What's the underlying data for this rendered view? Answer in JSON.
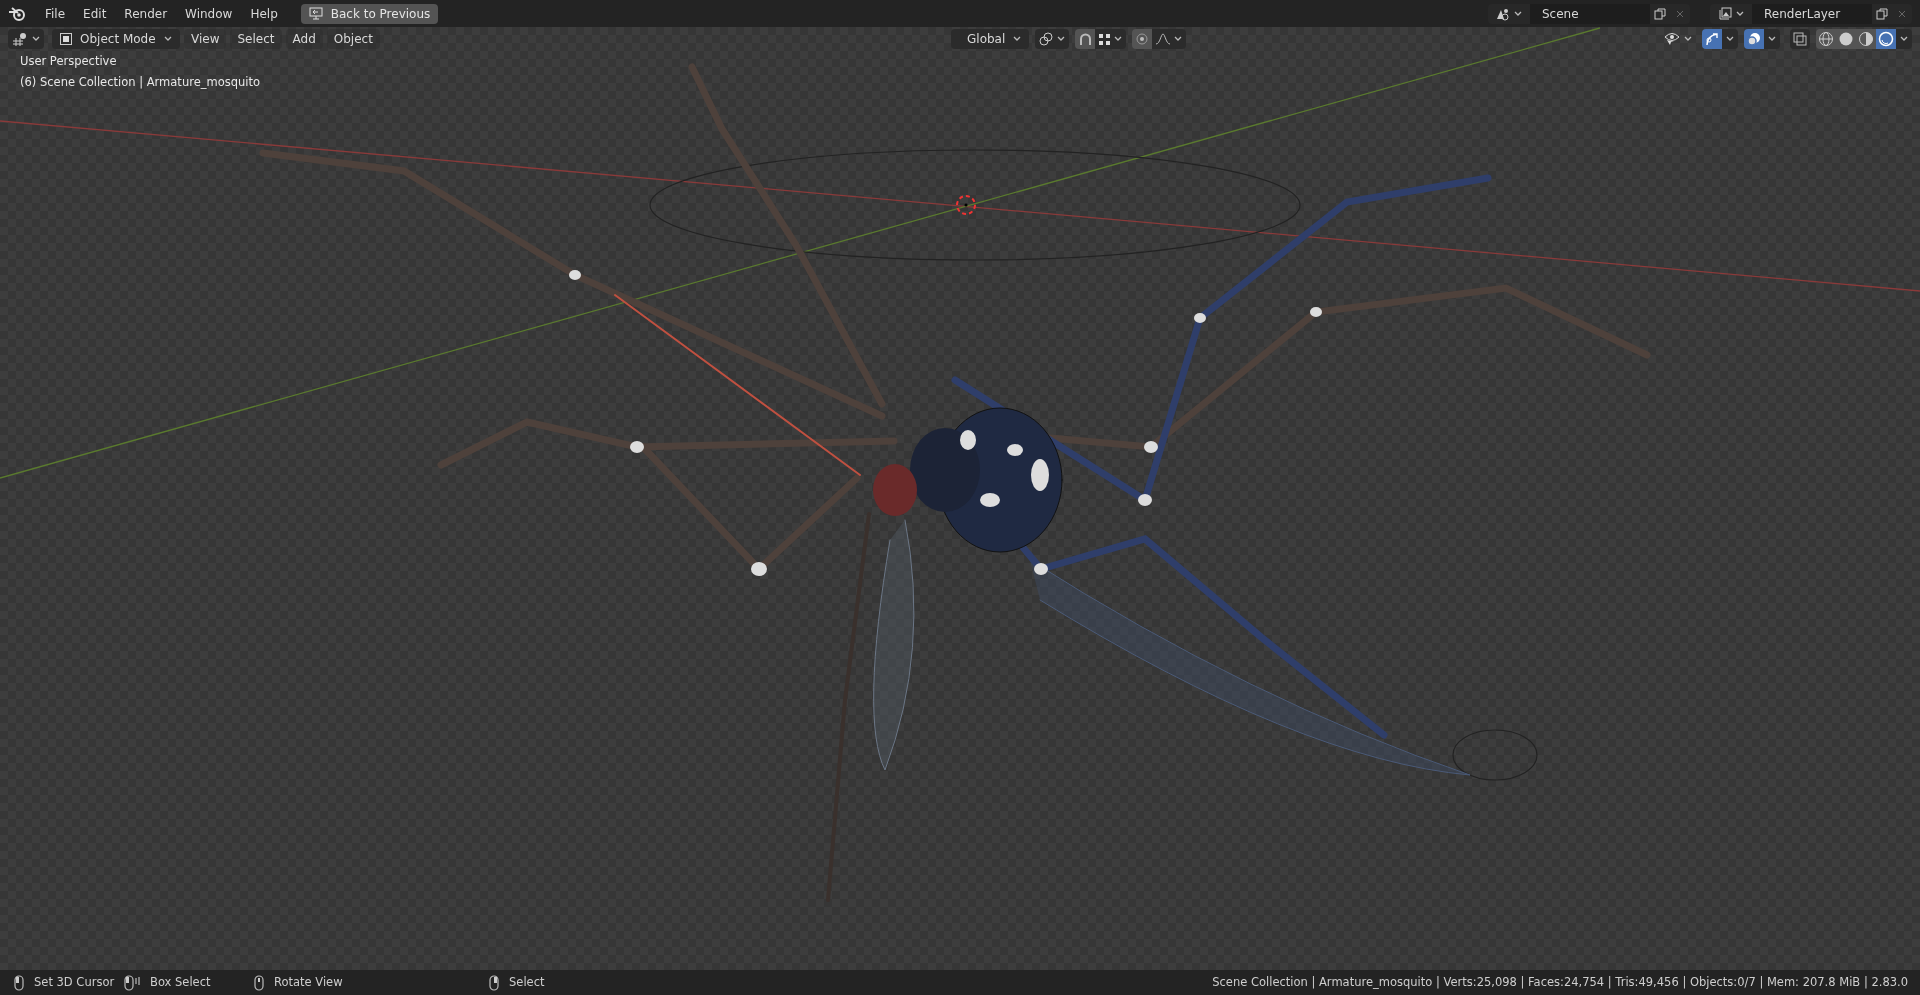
{
  "menu": [
    "File",
    "Edit",
    "Render",
    "Window",
    "Help"
  ],
  "back_button": "Back to Previous",
  "scene": {
    "name": "Scene"
  },
  "render_layer": {
    "name": "RenderLayer"
  },
  "header": {
    "mode": "Object Mode",
    "menus": [
      "View",
      "Select",
      "Add",
      "Object"
    ],
    "orientation": "Global",
    "snap_on": true,
    "proportional_on": true,
    "gizmo_on": true,
    "overlays_on": true,
    "xray_on": false,
    "shading": [
      {
        "kind": "wireframe",
        "selected": false
      },
      {
        "kind": "solid",
        "selected": false
      },
      {
        "kind": "material",
        "selected": false
      },
      {
        "kind": "rendered",
        "selected": true
      }
    ]
  },
  "overlay_text": [
    "User Perspective",
    "(6) Scene Collection | Armature_mosquito"
  ],
  "status": {
    "hints": [
      {
        "kind": "left",
        "label": "Set 3D Cursor"
      },
      {
        "kind": "drag",
        "label": "Box Select"
      },
      {
        "kind": "middle",
        "label": "Rotate View"
      },
      {
        "kind": "right",
        "label": "Select"
      }
    ],
    "info": "Scene Collection | Armature_mosquito | Verts:25,098 | Faces:24,754 | Tris:49,456 | Objects:0/7 | Mem: 207.8 MiB | 2.83.0"
  }
}
